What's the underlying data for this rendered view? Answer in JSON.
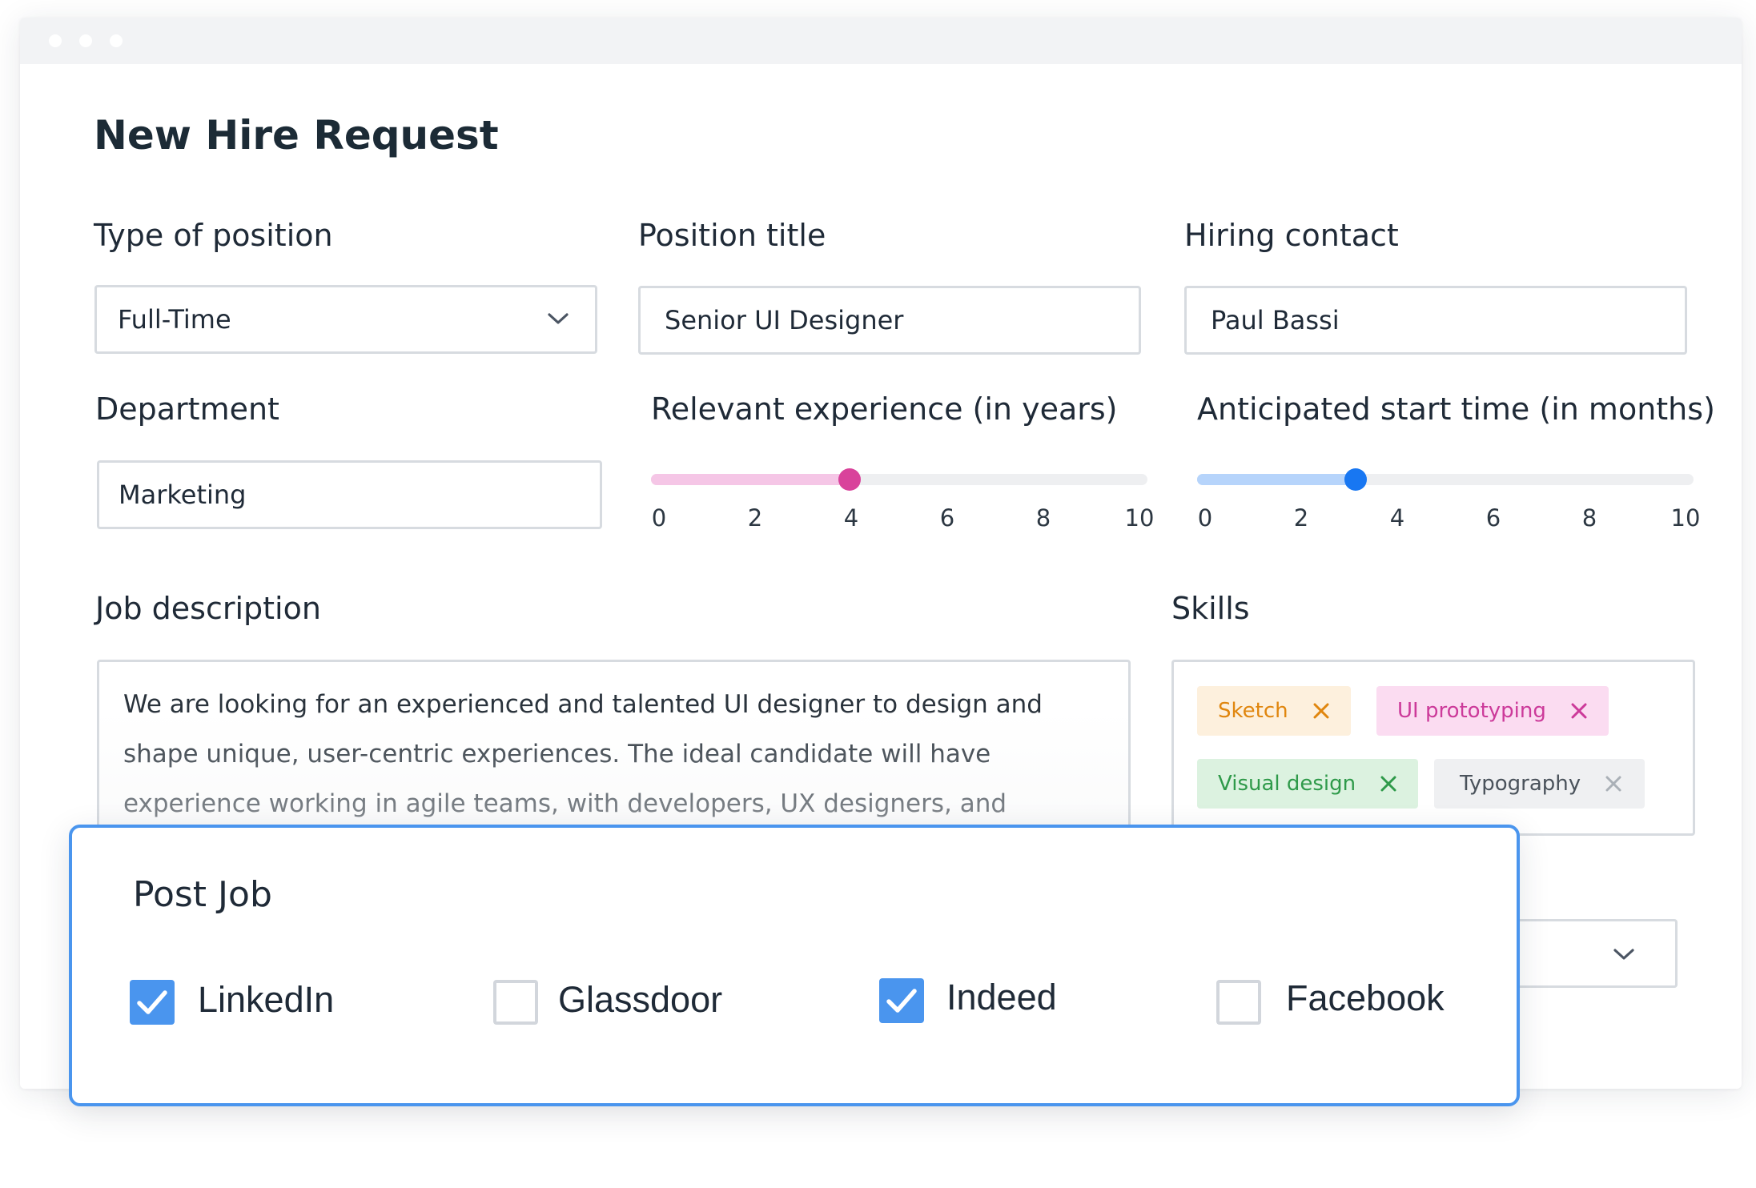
{
  "form": {
    "title": "New Hire Request",
    "type_of_position": {
      "label": "Type of position",
      "value": "Full-Time"
    },
    "position_title": {
      "label": "Position title",
      "value": "Senior UI Designer"
    },
    "hiring_contact": {
      "label": "Hiring contact",
      "value": "Paul Bassi"
    },
    "department": {
      "label": "Department",
      "value": "Marketing"
    },
    "experience": {
      "label": "Relevant experience (in years)",
      "value": 4,
      "min": 0,
      "max": 10,
      "ticks": [
        "0",
        "2",
        "4",
        "6",
        "8",
        "10"
      ],
      "color": "#d9429b",
      "fill_color": "#f5c6e6"
    },
    "start_time": {
      "label": "Anticipated start time (in months)",
      "value": 3.2,
      "min": 0,
      "max": 10,
      "ticks": [
        "0",
        "2",
        "4",
        "6",
        "8",
        "10"
      ],
      "color": "#1877f2",
      "fill_color": "#b6d4fb"
    },
    "job_description": {
      "label": "Job description",
      "value": "We are looking for an experienced and talented UI designer to design and shape unique, user-centric experiences. The ideal candidate will have experience working in agile teams, with developers, UX designers, and copywriters."
    },
    "skills": {
      "label": "Skills",
      "tags": [
        {
          "label": "Sketch",
          "color": "#e0860e",
          "bg": "#fdf0dd"
        },
        {
          "label": "UI prototyping",
          "color": "#cc3a9a",
          "bg": "#fbdcf1"
        },
        {
          "label": "Visual design",
          "color": "#2f9a4a",
          "bg": "#dcf2e0"
        },
        {
          "label": "Typography",
          "color": "#4a525b",
          "bg": "#eff0f2"
        }
      ]
    }
  },
  "modal": {
    "title": "Post Job",
    "options": [
      {
        "label": "LinkedIn",
        "checked": true
      },
      {
        "label": "Glassdoor",
        "checked": false
      },
      {
        "label": "Indeed",
        "checked": true
      },
      {
        "label": "Facebook",
        "checked": false
      }
    ]
  },
  "icons": {
    "select_chevron": "chevron-down-icon",
    "tag_remove": "close-icon",
    "checkbox_check": "checkmark-icon"
  },
  "colors": {
    "accent": "#4a95ee",
    "border": "#d7dbe0",
    "text": "#1f2a37"
  }
}
